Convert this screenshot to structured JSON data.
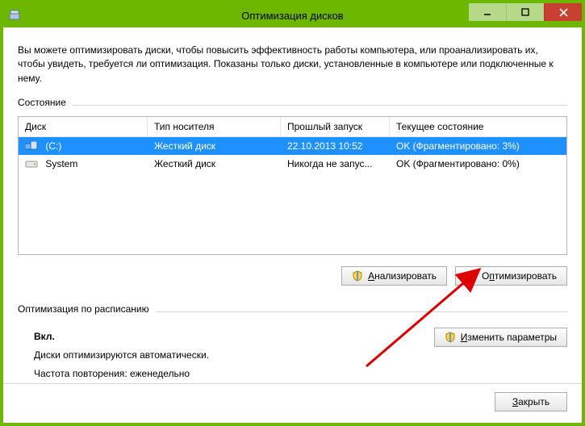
{
  "window": {
    "title": "Оптимизация дисков"
  },
  "intro": "Вы можете оптимизировать диски, чтобы повысить эффективность работы компьютера, или проанализировать их, чтобы увидеть, требуется ли оптимизация. Показаны только диски, установленные в компьютере или подключенные к нему.",
  "status_label": "Состояние",
  "columns": {
    "disk": "Диск",
    "media": "Тип носителя",
    "last_run": "Прошлый запуск",
    "current": "Текущее состояние"
  },
  "rows": [
    {
      "icon": "drive-c",
      "name": "(C:)",
      "media": "Жесткий диск",
      "last": "22.10.2013 10:52",
      "state": "OK (Фрагментировано: 3%)",
      "selected": true
    },
    {
      "icon": "drive-sys",
      "name": "System",
      "media": "Жесткий диск",
      "last": "Никогда не запус...",
      "state": "OK (Фрагментировано: 0%)",
      "selected": false
    }
  ],
  "buttons": {
    "analyze": "Анализировать",
    "analyze_hk": "А",
    "optimize": "Оптимизировать",
    "optimize_hk": "п",
    "change": "Изменить параметры",
    "change_hk": "И",
    "close": "Закрыть",
    "close_hk": "З"
  },
  "schedule": {
    "section": "Оптимизация по расписанию",
    "enabled_label": "Вкл.",
    "auto_line": "Диски оптимизируются автоматически.",
    "freq_label": "Частота повторения:",
    "freq_value": "еженедельно"
  },
  "colors": {
    "accent": "#6db700",
    "selection": "#1e90ff",
    "close": "#c84031",
    "arrow": "#dc0000"
  }
}
